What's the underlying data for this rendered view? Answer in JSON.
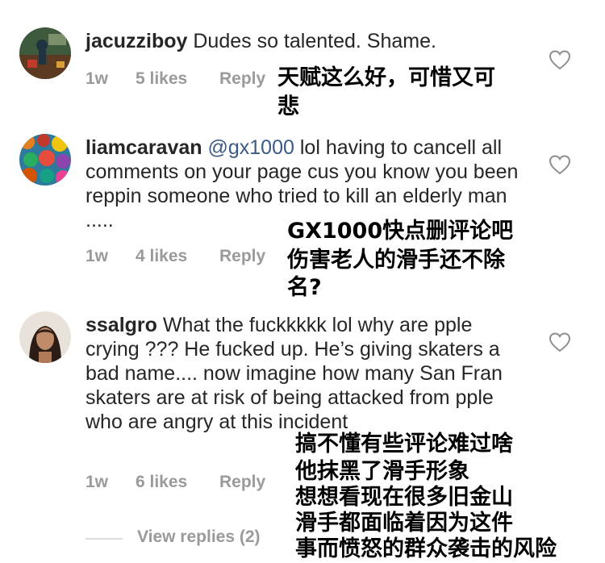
{
  "comments": [
    {
      "username": "jacuzziboy",
      "mention": "",
      "text": "Dudes so talented. Shame.",
      "time": "1w",
      "likes": "5 likes",
      "reply": "Reply",
      "annotation": [
        "天赋这么好，可惜又可",
        "悲"
      ]
    },
    {
      "username": "liamcaravan",
      "mention": "@gx1000",
      "text": "lol having to cancell all comments on your page cus you know you been reppin someone who tried to kill an elderly man .....",
      "time": "1w",
      "likes": "4 likes",
      "reply": "Reply",
      "annotation": [
        "GX1000快点删评论吧",
        "伤害老人的滑手还不除",
        "名?"
      ]
    },
    {
      "username": "ssalgro",
      "mention": "",
      "text": "What the fuckkkkk lol why are pple crying ??? He fucked up. He’s giving skaters a bad name.... now imagine how many San Fran skaters are at risk of being attacked from pple who are angry at this incident",
      "time": "1w",
      "likes": "6 likes",
      "reply": "Reply",
      "annotation": [
        "搞不懂有些评论难过啥",
        "他抹黑了滑手形象",
        "想想看现在很多旧金山",
        "滑手都面临着因为这件",
        "事而愤怒的群众袭击的风险"
      ]
    }
  ],
  "view_replies": "View replies (2)",
  "colors": {
    "meta": "#9a9a9a",
    "mention": "#3b5a87",
    "text": "#262626"
  },
  "icons": {
    "like": "heart-outline-icon"
  }
}
